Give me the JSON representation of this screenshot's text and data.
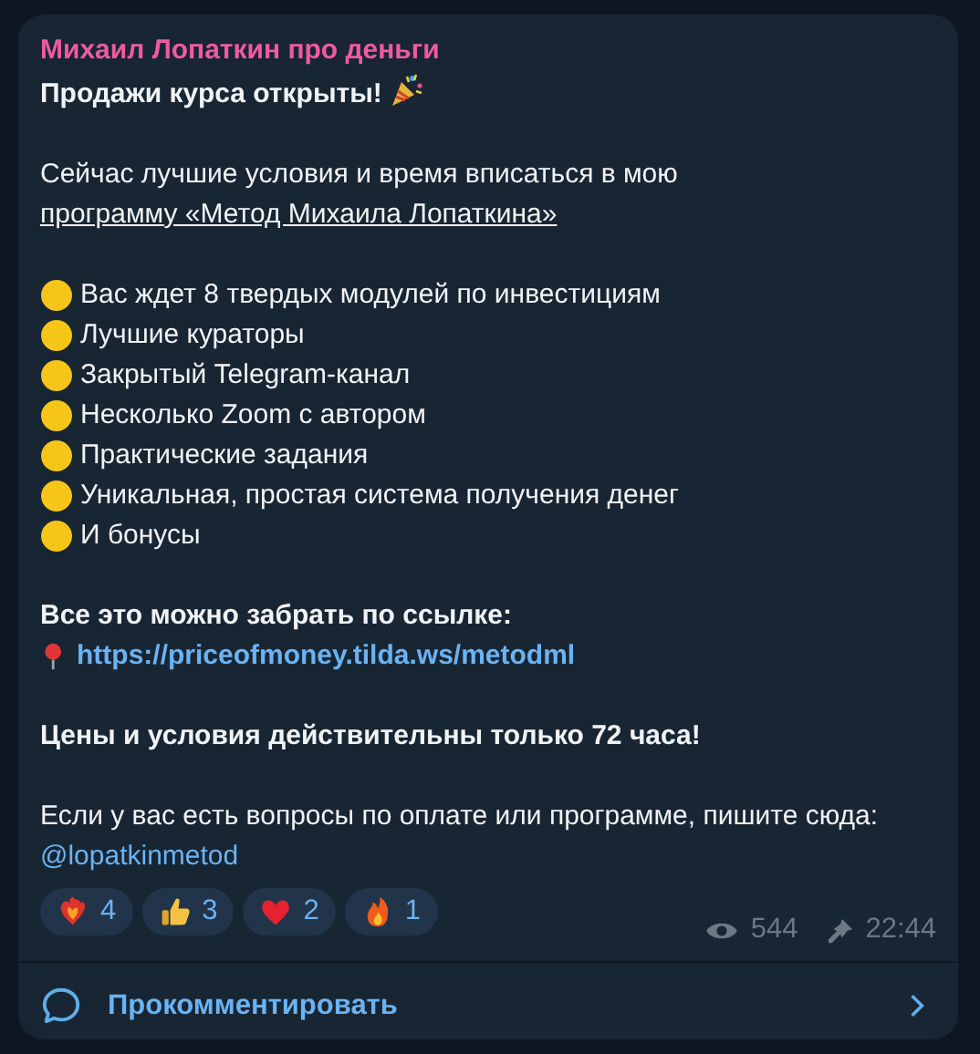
{
  "message": {
    "author": "Михаил Лопаткин про деньги",
    "headline": "Продажи курса открыты!",
    "intro": {
      "text": "Сейчас лучшие условия и время вписаться в мою ",
      "link": "программу «Метод Михаила Лопаткина»"
    },
    "features": [
      "Вас ждет 8 твердых модулей по инвестициям",
      "Лучшие кураторы",
      "Закрытый Telegram-канал",
      "Несколько Zoom с автором",
      "Практические задания",
      "Уникальная, простая система получения денег",
      "И бонусы"
    ],
    "cta": "Все это можно забрать по ссылке:",
    "url": "https://priceofmoney.tilda.ws/metodml",
    "notice": "Цены и условия действительны только 72 часа!",
    "contact": {
      "text": "Если у вас есть вопросы по оплате или программе, пишите сюда: ",
      "mention": "@lopatkinmetod"
    }
  },
  "reactions": [
    {
      "kind": "heart-fire",
      "count": "4"
    },
    {
      "kind": "thumbs-up",
      "count": "3"
    },
    {
      "kind": "heart",
      "count": "2"
    },
    {
      "kind": "fire",
      "count": "1"
    }
  ],
  "views": "544",
  "time": "22:44",
  "comment_button": "Прокомментировать"
}
